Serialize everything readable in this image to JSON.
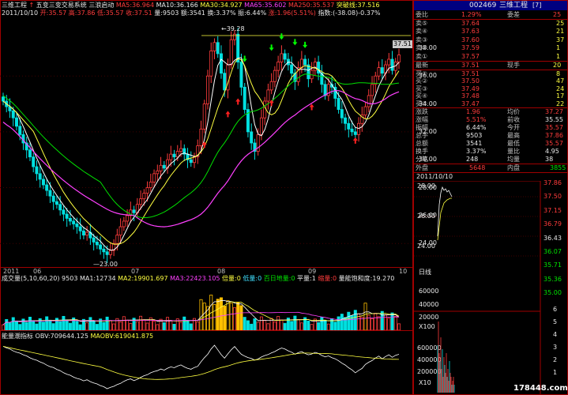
{
  "header": {
    "code_name": "三维工程",
    "indicator": "五变三变交易系统",
    "subtitle": "三浪启动",
    "mavalues": [
      {
        "label": "MA5:",
        "value": "36.964",
        "color": "#ff3c3c"
      },
      {
        "label": "MA10:",
        "value": "36.166",
        "color": "#e8e8e8"
      },
      {
        "label": "MA30:",
        "value": "34.927",
        "color": "#ffff40"
      },
      {
        "label": "MA65:",
        "value": "35.602",
        "color": "#ff40ff"
      },
      {
        "label": "MA250:",
        "value": "35.537",
        "color": "#ff3c3c"
      },
      {
        "label": "突破线:",
        "value": "37.516",
        "color": "#ffff40"
      }
    ],
    "row2": {
      "date": "2011/10/10",
      "items": [
        {
          "text": "开:35.57",
          "color": "#ff3c3c"
        },
        {
          "text": "高:37.86",
          "color": "#ff3c3c"
        },
        {
          "text": "低:35.57",
          "color": "#ff3c3c"
        },
        {
          "text": "收:37.51",
          "color": "#ff3c3c"
        },
        {
          "text": "量:9503",
          "color": "#e8e8e8"
        },
        {
          "text": "额:3541",
          "color": "#e8e8e8"
        },
        {
          "text": "换:3.37%",
          "color": "#e8e8e8"
        },
        {
          "text": "振:6.44%",
          "color": "#e8e8e8"
        },
        {
          "text": "涨:1.96(5.51%)",
          "color": "#ff3c3c"
        },
        {
          "text": "指数:(-38.08)-0.37%",
          "color": "#e8e8e8"
        }
      ]
    }
  },
  "price_axis": {
    "ticks": [
      "38.00",
      "36.00",
      "34.00",
      "32.00",
      "30.00",
      "28.00",
      "26.00",
      "24.00"
    ],
    "current": "37.51"
  },
  "annotations": {
    "high": "39.28",
    "low": "23.00"
  },
  "date_axis": [
    "2011",
    "06",
    "07",
    "08",
    "09",
    "10"
  ],
  "cycle_label": "日线",
  "volume": {
    "title": "成交量(5,10,60,20)",
    "items": [
      {
        "text": "9503",
        "color": "#e8e8e8"
      },
      {
        "text": "MA1:12734",
        "color": "#e8e8e8"
      },
      {
        "text": "MA2:19901.697",
        "color": "#ffff40"
      },
      {
        "text": "MA3:22423.105",
        "color": "#ff40ff"
      },
      {
        "text": "倍量:0",
        "color": "#ffff40"
      },
      {
        "text": "低量:0",
        "color": "#40e0ff"
      },
      {
        "text": "百日地量:0",
        "color": "#00e400"
      },
      {
        "text": "平量:1",
        "color": "#e8e8e8"
      },
      {
        "text": "缩量:0",
        "color": "#ff3c3c"
      },
      {
        "text": "量能饱和度:19.270",
        "color": "#e8e8e8"
      }
    ],
    "ticks": [
      "60000",
      "40000",
      "20000"
    ],
    "unit": "X100"
  },
  "obv": {
    "title": "能量潮指标",
    "items": [
      {
        "text": "OBV:709644.125",
        "color": "#e8e8e8"
      },
      {
        "text": "MAOBV:619041.875",
        "color": "#ffff40"
      }
    ],
    "ticks": [
      "600000",
      "400000",
      "200000"
    ],
    "unit": "X10"
  },
  "quote": {
    "code": "002469",
    "name": "三维工程",
    "page": "7",
    "weibi_label": "委比",
    "weibi": "1.29%",
    "weicha_label": "委差",
    "weicha": "25",
    "sells": [
      {
        "label": "卖⑤",
        "price": "37.64",
        "vol": "25"
      },
      {
        "label": "卖④",
        "price": "37.63",
        "vol": "21"
      },
      {
        "label": "卖③",
        "price": "37.60",
        "vol": "37"
      },
      {
        "label": "卖②",
        "price": "37.59",
        "vol": "1"
      },
      {
        "label": "卖①",
        "price": "37.57",
        "vol": "1"
      }
    ],
    "latest_label": "最新",
    "latest": "37.51",
    "xianshou_label": "现手",
    "xianshou": "20",
    "buys": [
      {
        "label": "买①",
        "price": "37.51",
        "vol": "8"
      },
      {
        "label": "买②",
        "price": "37.50",
        "vol": "47"
      },
      {
        "label": "买③",
        "price": "37.49",
        "vol": "24"
      },
      {
        "label": "买④",
        "price": "37.48",
        "vol": "17"
      },
      {
        "label": "买⑤",
        "price": "37.47",
        "vol": "22"
      }
    ],
    "stats": [
      {
        "l1": "涨跌",
        "v1": "1.96",
        "c1": "#ff3c3c",
        "l2": "均价",
        "v2": "37.27",
        "c2": "#ff3c3c"
      },
      {
        "l1": "涨幅",
        "v1": "5.51%",
        "c1": "#ff3c3c",
        "l2": "前收",
        "v2": "35.55",
        "c2": "#e8e8e8"
      },
      {
        "l1": "振幅",
        "v1": "6.44%",
        "c1": "#e8e8e8",
        "l2": "今开",
        "v2": "35.57",
        "c2": "#ff3c3c"
      },
      {
        "l1": "总手",
        "v1": "9503",
        "c1": "#e8e8e8",
        "l2": "最高",
        "v2": "37.86",
        "c2": "#ff3c3c"
      },
      {
        "l1": "总额",
        "v1": "3541",
        "c1": "#e8e8e8",
        "l2": "最低",
        "v2": "35.57",
        "c2": "#ff3c3c"
      },
      {
        "l1": "换手",
        "v1": "3.37%",
        "c1": "#e8e8e8",
        "l2": "量比",
        "v2": "4.95",
        "c2": "#e8e8e8"
      },
      {
        "l1": "分笔",
        "v1": "248",
        "c1": "#e8e8e8",
        "l2": "均量",
        "v2": "38",
        "c2": "#e8e8e8"
      }
    ],
    "waipan_label": "外盘",
    "waipan": "5648",
    "neipan_label": "内盘",
    "neipan": "3855",
    "intraday_date": "2011/10/10",
    "intraday_left_ticks": [
      "28.00",
      "26.00",
      "24.00"
    ],
    "intraday_right_ticks": [
      "37.86",
      "37.50",
      "37.15",
      "36.79",
      "36.43",
      "36.07",
      "35.71",
      "35.36",
      "35.00"
    ],
    "intraday_vol_ticks": [
      "6",
      "5",
      "4",
      "3",
      "2",
      "1"
    ],
    "watermark": "178448.com"
  }
}
